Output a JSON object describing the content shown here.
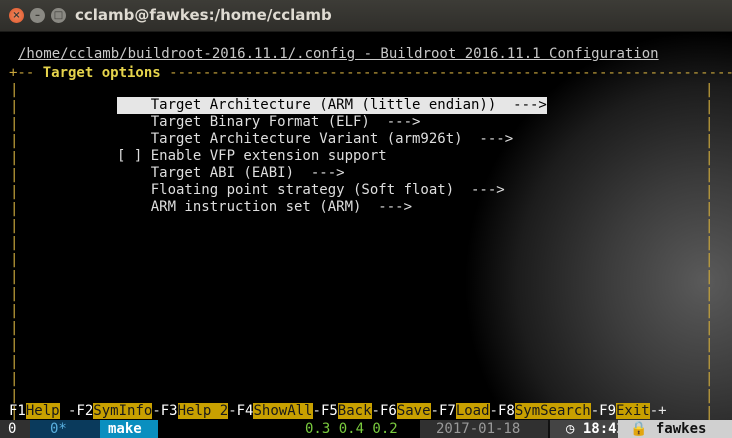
{
  "window": {
    "title": "cclamb@fawkes:/home/cclamb"
  },
  "header": {
    "path": "/home/cclamb/buildroot-2016.11.1/.config - Buildroot 2016.11.1 Configuration",
    "frame_prefix": "+-- ",
    "section_title": "Target options",
    "frame_suffix": " -----------------------------------------------------------------------+"
  },
  "menu": {
    "items": [
      {
        "text": "    Target Architecture (ARM (little endian))  --->",
        "selected": true
      },
      {
        "text": "    Target Binary Format (ELF)  --->"
      },
      {
        "text": "    Target Architecture Variant (arm926t)  --->"
      },
      {
        "text": "[ ] Enable VFP extension support"
      },
      {
        "text": "    Target ABI (EABI)  --->"
      },
      {
        "text": "    Floating point strategy (Soft float)  --->"
      },
      {
        "text": "    ARM instruction set (ARM)  --->"
      }
    ]
  },
  "fkeys": [
    {
      "key": "F1",
      "label": "Help"
    },
    {
      "key": "F2",
      "label": "SymInfo"
    },
    {
      "key": "F3",
      "label": "Help 2"
    },
    {
      "key": "F4",
      "label": "ShowAll"
    },
    {
      "key": "F5",
      "label": "Back"
    },
    {
      "key": "F6",
      "label": "Save"
    },
    {
      "key": "F7",
      "label": "Load"
    },
    {
      "key": "F8",
      "label": "SymSearch"
    },
    {
      "key": "F9",
      "label": "Exit"
    }
  ],
  "tmux": {
    "window0": "0",
    "window1": "0*",
    "window_name": "make",
    "load": "0.3 0.4 0.2",
    "date": "2017-01-18",
    "time": "18:42",
    "host": "fawkes",
    "lock_icon": "lock-icon",
    "clock_icon": "clock-icon"
  },
  "colors": {
    "accent": "#e0562a",
    "frame": "#c8a53c",
    "fkey_label_bg": "#c8a000",
    "tmux_make": "#0a8fbf"
  }
}
